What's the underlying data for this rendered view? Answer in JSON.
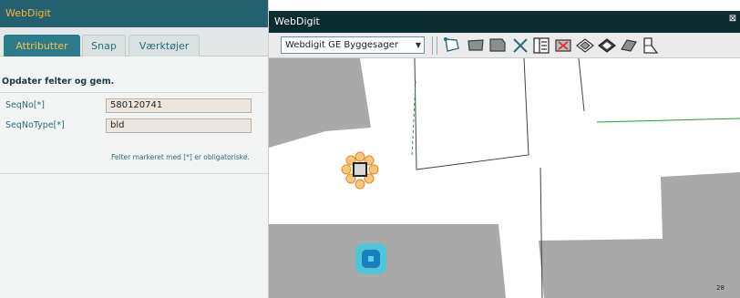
{
  "left_panel": {
    "header_title": "WebDigit",
    "tabs": [
      {
        "label": "Attributter",
        "active": true
      },
      {
        "label": "Snap",
        "active": false
      },
      {
        "label": "Værktøjer",
        "active": false
      }
    ],
    "section_title": "Opdater felter og gem.",
    "fields": [
      {
        "label": "SeqNo[*]",
        "value": "580120741"
      },
      {
        "label": "SeqNoType[*]",
        "value": "bld"
      }
    ],
    "note": "Felter markeret med [*] er obligatoriske."
  },
  "map_window": {
    "title": "WebDigit",
    "close_glyph": "⊠",
    "layer_select": {
      "selected": "Webdigit GE Byggesager"
    },
    "tools": [
      "draw-polyline-icon",
      "draw-polygon-icon",
      "draw-rectangle-icon",
      "delete-icon",
      "edit-attributes-icon",
      "delete-feature-icon",
      "move-feature-icon",
      "rotate-feature-icon",
      "reshape-feature-icon",
      "split-feature-icon"
    ],
    "parcel_label": "28"
  },
  "colors": {
    "header_bg": "#25606f",
    "header_text": "#f0b838",
    "tab_active_bg": "#2c7b8a",
    "map_titlebar": "#0c2d30",
    "parcel_gray": "#a9a9a9",
    "vertex_orange": "#f6c77a",
    "selection_teal": "#4fc6d6",
    "selection_blue": "#1a7fc0"
  }
}
